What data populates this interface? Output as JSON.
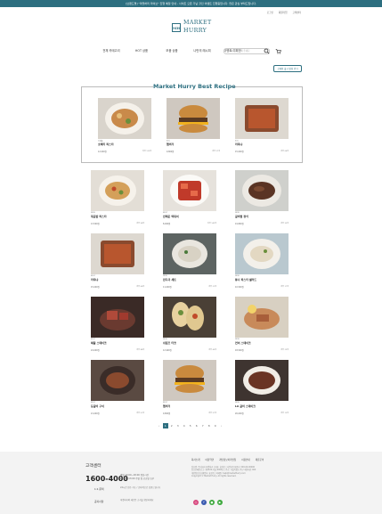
{
  "topbar": {
    "text": "[브랜드명] \"마켓허리 라이브\" 진행 예정 안내 - 사이트 오픈 기념 할인 이벤트 진행중입니다. 많은 관심 부탁드립니다."
  },
  "util_links": [
    "로그인",
    "회원가입",
    "고객센터"
  ],
  "logo": {
    "mark": "MH",
    "word": "MARKET HURRY"
  },
  "nav": [
    "전체 카테고리",
    "HOT 상품",
    "모음 상품",
    "나만의 레시피",
    "이벤트 기획전"
  ],
  "search": {
    "placeholder": "검색어를 입력해 주세요"
  },
  "new_button": "신제품 출시 알림 받기",
  "best_title": "Market Hurry Best Recipe",
  "best_items": [
    {
      "tag": "신제품",
      "name": "호페티 파스타",
      "price": "12,000원",
      "meta": "리뷰 123개"
    },
    {
      "tag": "인기",
      "name": "햄버거",
      "price": "9,800원",
      "meta": "리뷰 97개"
    },
    {
      "tag": "인기",
      "name": "라자냐",
      "price": "15,000원",
      "meta": "리뷰 64개"
    }
  ],
  "grid_items": [
    {
      "tag": "NEW",
      "name": "볶음밥 파스타",
      "price": "13,500원",
      "meta": "리뷰 58개"
    },
    {
      "tag": "BEST",
      "name": "안매운 떡볶이",
      "price": "8,900원",
      "meta": "리뷰 142개"
    },
    {
      "tag": "NEW",
      "name": "갈비찜 정식",
      "price": "19,800원",
      "meta": "리뷰 33개"
    },
    {
      "tag": "BEST",
      "name": "라자냐",
      "price": "15,000원",
      "meta": "리뷰 64개"
    },
    {
      "tag": "NEW",
      "name": "만두국 세트",
      "price": "11,000원",
      "meta": "리뷰 21개"
    },
    {
      "tag": "NEW",
      "name": "튜나 파스타 샐러드",
      "price": "10,500원",
      "meta": "리뷰 17개"
    },
    {
      "tag": "BEST",
      "name": "채끝 스테이크",
      "price": "24,000원",
      "meta": "리뷰 88개"
    },
    {
      "tag": "NEW",
      "name": "쉬림프 타코",
      "price": "12,900원",
      "meta": "리뷰 45개"
    },
    {
      "tag": "NEW",
      "name": "연어 스테이크",
      "price": "18,500원",
      "meta": "리뷰 29개"
    },
    {
      "tag": "BEST",
      "name": "등갈비 구이",
      "price": "21,000원",
      "meta": "리뷰 51개"
    },
    {
      "tag": "BEST",
      "name": "햄버거",
      "price": "9,800원",
      "meta": "리뷰 97개"
    },
    {
      "tag": "NEW",
      "name": "LA 갈비 스테이크",
      "price": "26,000원",
      "meta": "리뷰 12개"
    }
  ],
  "pager": [
    "‹",
    "1",
    "2",
    "3",
    "4",
    "5",
    "6",
    "7",
    "8",
    "9",
    "›"
  ],
  "footer": {
    "title": "고객센터",
    "phone": "1600-4000",
    "hours": "평일 10:00~18:00 점심시간 12:00~13:00 주말 및 공휴일 휴무",
    "rows": [
      {
        "label": "1:1 문의",
        "text": "24시간 접수 가능 / 순차적으로 답변드립니다"
      },
      {
        "label": "공지사항",
        "text": "마켓허리의 새로운 소식을 확인하세요"
      }
    ],
    "links": [
      "회사소개",
      "이용약관",
      "개인정보처리방침",
      "이용안내",
      "제휴문의"
    ],
    "info": [
      "상호명: 주식회사 마켓허리 | 대표: 홍길동 | 사업자등록번호: 000-00-00000",
      "통신판매업신고: 제2024-서울-0000호 | 주소: 서울특별시 중구 세종대로 000",
      "개인정보보호책임자: 홍길동 | 이메일: help@markethurry.com",
      "Copyright © Market Hurry. All rights reserved."
    ],
    "sns": [
      "instagram-icon",
      "facebook-icon",
      "kakao-icon",
      "youtube-icon"
    ]
  }
}
